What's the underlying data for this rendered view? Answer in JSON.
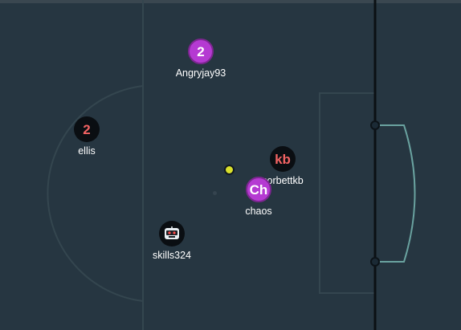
{
  "players": [
    {
      "id": "angryjay93",
      "name": "Angryjay93",
      "avatar_text": "2",
      "team": "blue"
    },
    {
      "id": "ellis",
      "name": "ellis",
      "avatar_text": "2",
      "team": "red"
    },
    {
      "id": "corbettkb",
      "name": "corbettkb",
      "avatar_text": "kb",
      "team": "red"
    },
    {
      "id": "chaos",
      "name": "chaos",
      "avatar_text": "Ch",
      "team": "blue"
    },
    {
      "id": "skills324",
      "name": "skills324",
      "avatar_text": "",
      "avatar_icon": "robot-face-icon",
      "team": "red"
    }
  ],
  "colors": {
    "field": "#263641",
    "red_team_text": "#f26363",
    "blue_team_fill": "#b53ad2",
    "ball": "#d9e02b",
    "goal_net": "#6aa3a0"
  }
}
